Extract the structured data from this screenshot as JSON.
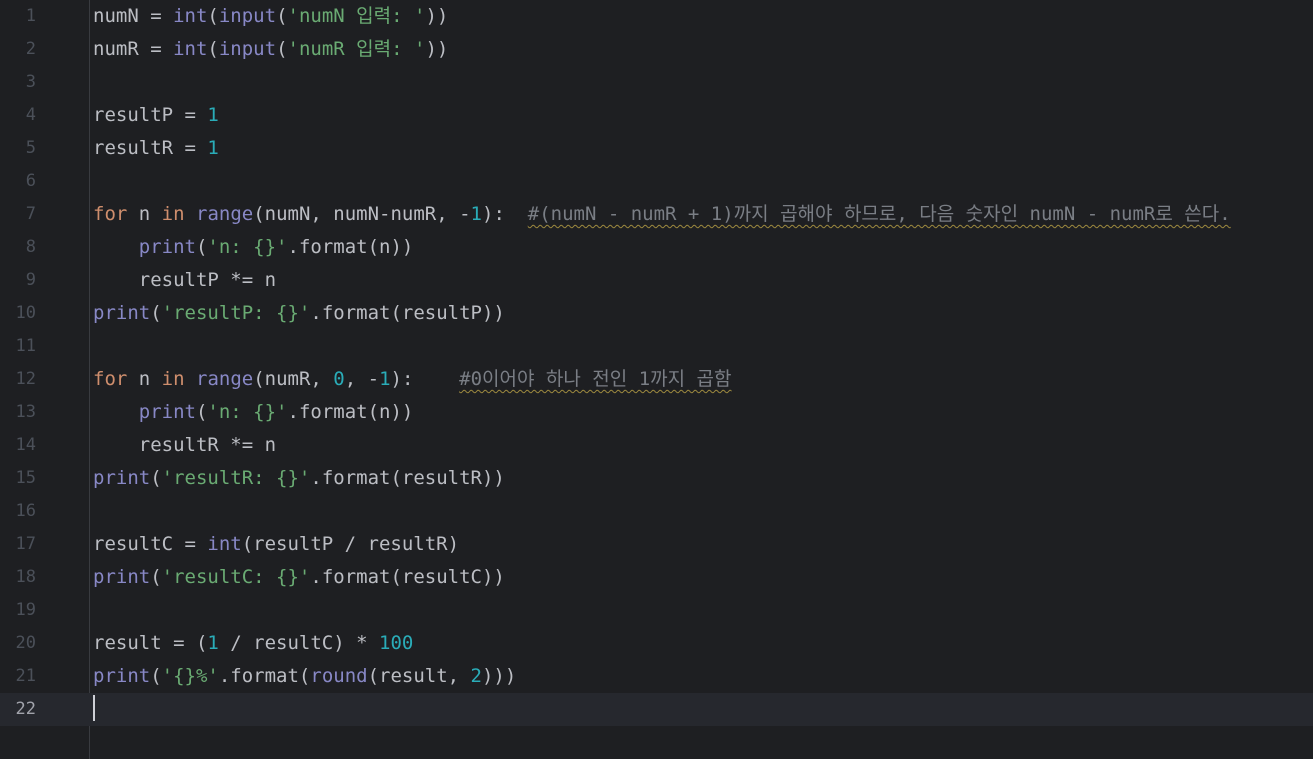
{
  "editor": {
    "current_line": 22,
    "lines": [
      {
        "number": "1",
        "tokens": [
          {
            "t": "numN = ",
            "k": "plain"
          },
          {
            "t": "int",
            "k": "builtin"
          },
          {
            "t": "(",
            "k": "plain"
          },
          {
            "t": "input",
            "k": "builtin"
          },
          {
            "t": "(",
            "k": "plain"
          },
          {
            "t": "'numN 입력: '",
            "k": "string"
          },
          {
            "t": "))",
            "k": "plain"
          }
        ]
      },
      {
        "number": "2",
        "tokens": [
          {
            "t": "numR = ",
            "k": "plain"
          },
          {
            "t": "int",
            "k": "builtin"
          },
          {
            "t": "(",
            "k": "plain"
          },
          {
            "t": "input",
            "k": "builtin"
          },
          {
            "t": "(",
            "k": "plain"
          },
          {
            "t": "'numR 입력: '",
            "k": "string"
          },
          {
            "t": "))",
            "k": "plain"
          }
        ]
      },
      {
        "number": "3",
        "tokens": []
      },
      {
        "number": "4",
        "tokens": [
          {
            "t": "resultP = ",
            "k": "plain"
          },
          {
            "t": "1",
            "k": "number"
          }
        ]
      },
      {
        "number": "5",
        "tokens": [
          {
            "t": "resultR = ",
            "k": "plain"
          },
          {
            "t": "1",
            "k": "number"
          }
        ]
      },
      {
        "number": "6",
        "tokens": []
      },
      {
        "number": "7",
        "tokens": [
          {
            "t": "for",
            "k": "keyword"
          },
          {
            "t": " n ",
            "k": "plain"
          },
          {
            "t": "in",
            "k": "keyword"
          },
          {
            "t": " ",
            "k": "plain"
          },
          {
            "t": "range",
            "k": "builtin"
          },
          {
            "t": "(numN, numN-numR, -",
            "k": "plain"
          },
          {
            "t": "1",
            "k": "number"
          },
          {
            "t": "):  ",
            "k": "plain"
          },
          {
            "t": "#(numN - numR + 1)까지 곱해야 하므로, 다음 숫자인 numN - numR로 쓴다.",
            "k": "comment"
          }
        ]
      },
      {
        "number": "8",
        "tokens": [
          {
            "t": "    ",
            "k": "plain"
          },
          {
            "t": "print",
            "k": "builtin"
          },
          {
            "t": "(",
            "k": "plain"
          },
          {
            "t": "'n: {}'",
            "k": "string"
          },
          {
            "t": ".format(n))",
            "k": "plain"
          }
        ]
      },
      {
        "number": "9",
        "tokens": [
          {
            "t": "    resultP *= n",
            "k": "plain"
          }
        ]
      },
      {
        "number": "10",
        "tokens": [
          {
            "t": "print",
            "k": "builtin"
          },
          {
            "t": "(",
            "k": "plain"
          },
          {
            "t": "'resultP: {}'",
            "k": "string"
          },
          {
            "t": ".format(resultP))",
            "k": "plain"
          }
        ]
      },
      {
        "number": "11",
        "tokens": []
      },
      {
        "number": "12",
        "tokens": [
          {
            "t": "for",
            "k": "keyword"
          },
          {
            "t": " n ",
            "k": "plain"
          },
          {
            "t": "in",
            "k": "keyword"
          },
          {
            "t": " ",
            "k": "plain"
          },
          {
            "t": "range",
            "k": "builtin"
          },
          {
            "t": "(numR, ",
            "k": "plain"
          },
          {
            "t": "0",
            "k": "number"
          },
          {
            "t": ", -",
            "k": "plain"
          },
          {
            "t": "1",
            "k": "number"
          },
          {
            "t": "):    ",
            "k": "plain"
          },
          {
            "t": "#0이어야 하나 전인 1까지 곱함",
            "k": "comment"
          }
        ]
      },
      {
        "number": "13",
        "tokens": [
          {
            "t": "    ",
            "k": "plain"
          },
          {
            "t": "print",
            "k": "builtin"
          },
          {
            "t": "(",
            "k": "plain"
          },
          {
            "t": "'n: {}'",
            "k": "string"
          },
          {
            "t": ".format(n))",
            "k": "plain"
          }
        ]
      },
      {
        "number": "14",
        "tokens": [
          {
            "t": "    resultR *= n",
            "k": "plain"
          }
        ]
      },
      {
        "number": "15",
        "tokens": [
          {
            "t": "print",
            "k": "builtin"
          },
          {
            "t": "(",
            "k": "plain"
          },
          {
            "t": "'resultR: {}'",
            "k": "string"
          },
          {
            "t": ".format(resultR))",
            "k": "plain"
          }
        ]
      },
      {
        "number": "16",
        "tokens": []
      },
      {
        "number": "17",
        "tokens": [
          {
            "t": "resultC = ",
            "k": "plain"
          },
          {
            "t": "int",
            "k": "builtin"
          },
          {
            "t": "(resultP / resultR)",
            "k": "plain"
          }
        ]
      },
      {
        "number": "18",
        "tokens": [
          {
            "t": "print",
            "k": "builtin"
          },
          {
            "t": "(",
            "k": "plain"
          },
          {
            "t": "'resultC: {}'",
            "k": "string"
          },
          {
            "t": ".format(resultC))",
            "k": "plain"
          }
        ]
      },
      {
        "number": "19",
        "tokens": []
      },
      {
        "number": "20",
        "tokens": [
          {
            "t": "result = (",
            "k": "plain"
          },
          {
            "t": "1",
            "k": "number"
          },
          {
            "t": " / resultC) * ",
            "k": "plain"
          },
          {
            "t": "100",
            "k": "number"
          }
        ]
      },
      {
        "number": "21",
        "tokens": [
          {
            "t": "print",
            "k": "builtin"
          },
          {
            "t": "(",
            "k": "plain"
          },
          {
            "t": "'{}%'",
            "k": "string"
          },
          {
            "t": ".format(",
            "k": "plain"
          },
          {
            "t": "round",
            "k": "builtin"
          },
          {
            "t": "(result, ",
            "k": "plain"
          },
          {
            "t": "2",
            "k": "number"
          },
          {
            "t": ")))",
            "k": "plain"
          }
        ]
      },
      {
        "number": "22",
        "tokens": []
      }
    ]
  }
}
